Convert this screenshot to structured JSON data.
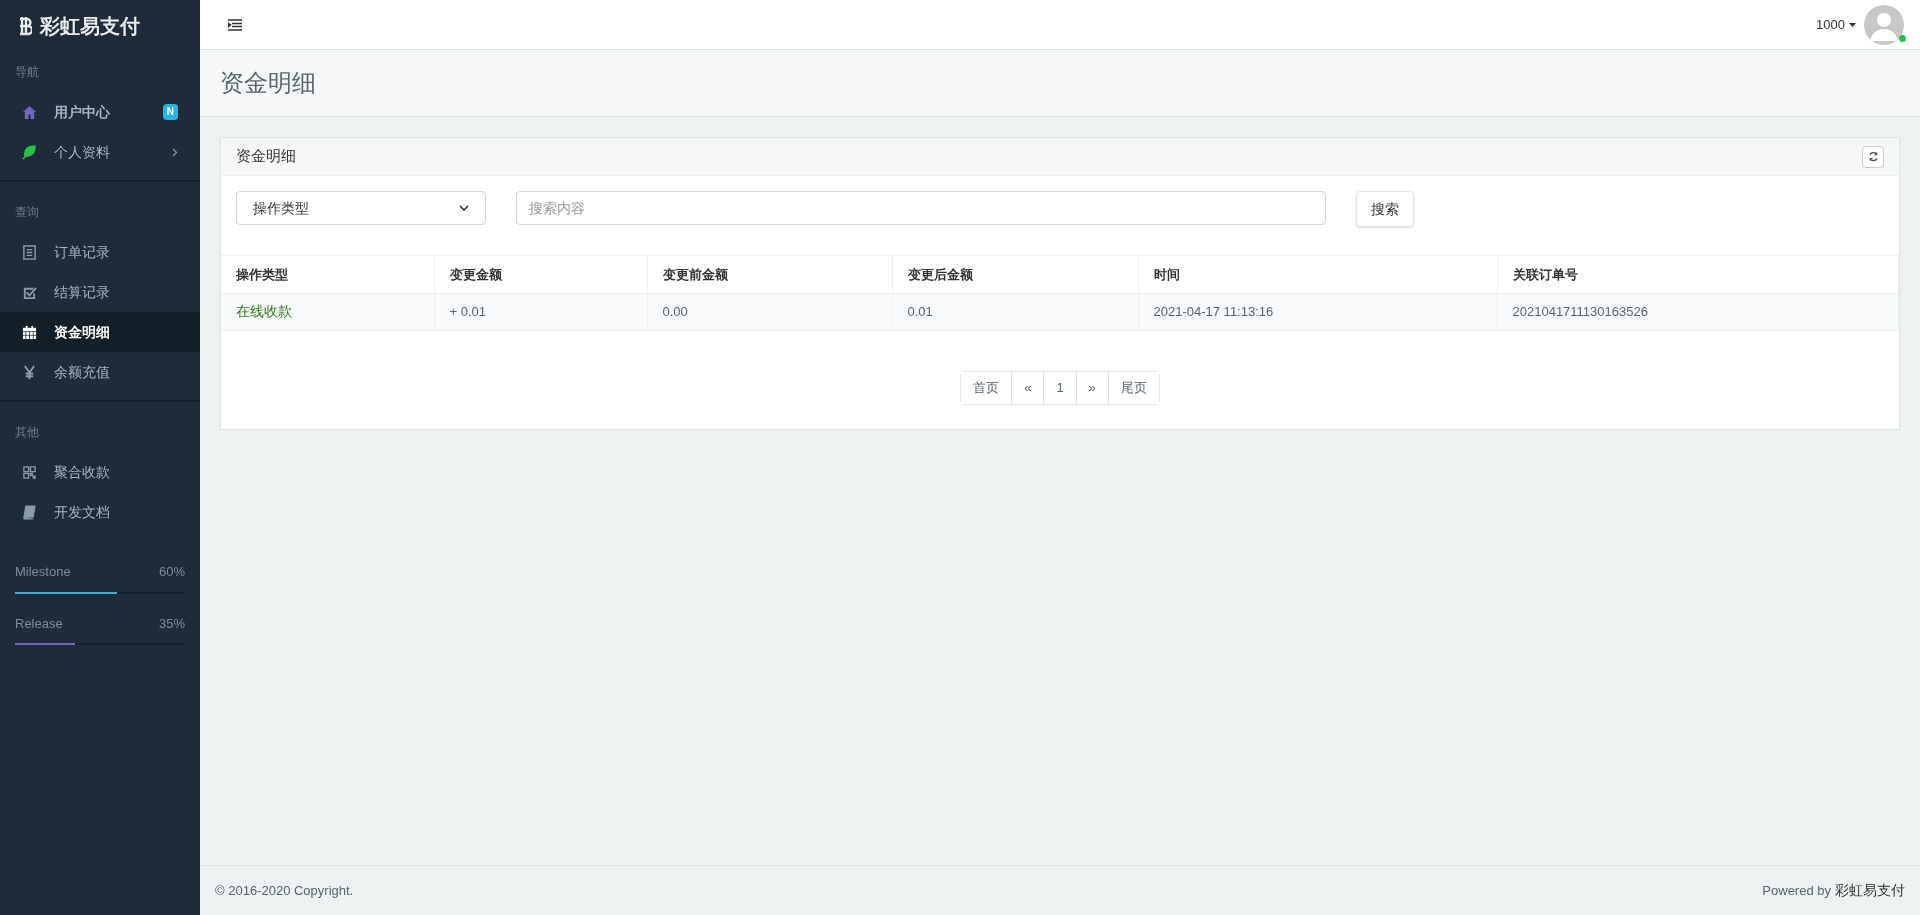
{
  "brand": {
    "title": "彩虹易支付"
  },
  "sidebar": {
    "sections": [
      {
        "label": "导航",
        "items": [
          {
            "label": "用户中心",
            "selected": false,
            "badge": "N",
            "has_submenu": false
          },
          {
            "label": "个人资料",
            "selected": false,
            "has_submenu": true
          }
        ]
      },
      {
        "label": "查询",
        "items": [
          {
            "label": "订单记录",
            "selected": false,
            "has_submenu": false
          },
          {
            "label": "结算记录",
            "selected": false,
            "has_submenu": false
          },
          {
            "label": "资金明细",
            "selected": true,
            "has_submenu": false
          },
          {
            "label": "余额充值",
            "selected": false,
            "has_submenu": false
          }
        ]
      },
      {
        "label": "其他",
        "items": [
          {
            "label": "聚合收款",
            "selected": false,
            "has_submenu": false
          },
          {
            "label": "开发文档",
            "selected": false,
            "has_submenu": false
          }
        ]
      }
    ],
    "progress": [
      {
        "label": "Milestone",
        "reading": "60%",
        "level": 0.6,
        "color": "#3bafda"
      },
      {
        "label": "Release",
        "reading": "35%",
        "level": 0.35,
        "color": "#7266ba"
      }
    ]
  },
  "header": {
    "user": "1000"
  },
  "page_title": "资金明细",
  "panel": {
    "title": "资金明细",
    "filter": {
      "value": "操作类型"
    },
    "search": {
      "placeholder": "搜索内容"
    },
    "search_button": "搜索",
    "table": {
      "columns": [
        "操作类型",
        "变更金额",
        "变更前金额",
        "变更后金额",
        "时间",
        "关联订单号"
      ],
      "rows": [
        {
          "cells": [
            "在线收款",
            "+ 0.01",
            "0.00",
            "0.01",
            "2021-04-17 11:13:16",
            "2021041711130163526"
          ]
        }
      ]
    },
    "pagination": [
      "首页",
      "«",
      "1",
      "»",
      "尾页"
    ]
  },
  "footer": {
    "copyright": "© 2016-2020 Copyright.",
    "powered_by": "Powered by",
    "brand": "彩虹易支付"
  }
}
